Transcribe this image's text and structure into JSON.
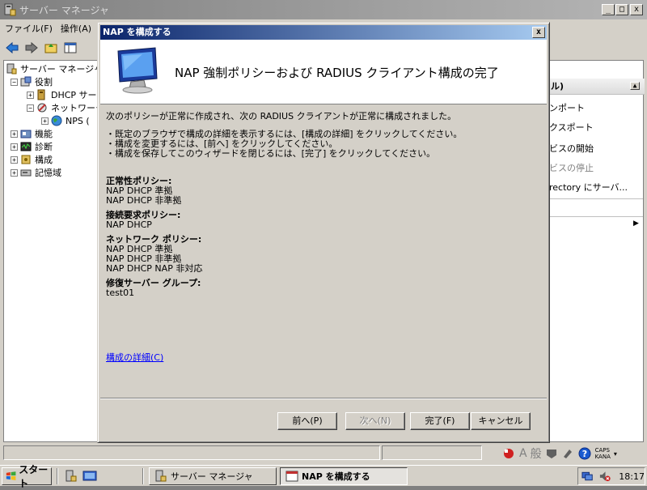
{
  "background_window": {
    "title": "サーバー マネージャ",
    "menu": [
      "ファイル(F)",
      "操作(A)"
    ],
    "tree": [
      {
        "label": "サーバー マネージャ",
        "expander": ""
      },
      {
        "label": "役割",
        "expander": "−"
      },
      {
        "label": "DHCP サー",
        "expander": "+"
      },
      {
        "label": "ネットワーク",
        "expander": "−"
      },
      {
        "label": "NPS (",
        "expander": "+"
      },
      {
        "label": "機能",
        "expander": "+"
      },
      {
        "label": "診断",
        "expander": "+"
      },
      {
        "label": "構成",
        "expander": "+"
      },
      {
        "label": "記憶域",
        "expander": "+"
      }
    ],
    "actions": {
      "header": "ル)",
      "items": [
        "ンポート",
        "クスポート",
        "ビスの開始",
        "ビスの停止",
        "rectory にサーバ..."
      ]
    }
  },
  "dialog": {
    "title": "NAP を構成する",
    "heading": "NAP 強制ポリシーおよび RADIUS クライアント構成の完了",
    "intro": "次のポリシーが正常に作成され、次の RADIUS クライアントが正常に構成されました。",
    "bullets": [
      "・既定のブラウザで構成の詳細を表示するには、[構成の詳細] をクリックしてください。",
      "・構成を変更するには、[前へ] をクリックしてください。",
      "・構成を保存してこのウィザードを閉じるには、[完了] をクリックしてください。"
    ],
    "sections": [
      {
        "title": "正常性ポリシー:",
        "items": [
          "NAP DHCP 準拠",
          "NAP DHCP 非準拠"
        ]
      },
      {
        "title": "接続要求ポリシー:",
        "items": [
          "NAP DHCP"
        ]
      },
      {
        "title": "ネットワーク ポリシー:",
        "items": [
          "NAP DHCP 準拠",
          "NAP DHCP 非準拠",
          "NAP DHCP NAP 非対応"
        ]
      },
      {
        "title": "修復サーバー グループ:",
        "items": [
          "test01"
        ]
      }
    ],
    "details_link": "構成の詳細(C)",
    "buttons": {
      "back": "前へ(P)",
      "next": "次へ(N)",
      "finish": "完了(F)",
      "cancel": "キャンセル"
    }
  },
  "taskbar": {
    "start": "スタート",
    "tasks": [
      "サーバー マネージャ",
      "NAP を構成する"
    ],
    "clock": "18:17",
    "ime": {
      "a": "A",
      "mode": "般",
      "caps": "CAPS",
      "kana": "KANA"
    }
  },
  "colors": {
    "title_active": "#0a246a",
    "title_inactive": "#808080",
    "link": "#0000ff"
  }
}
